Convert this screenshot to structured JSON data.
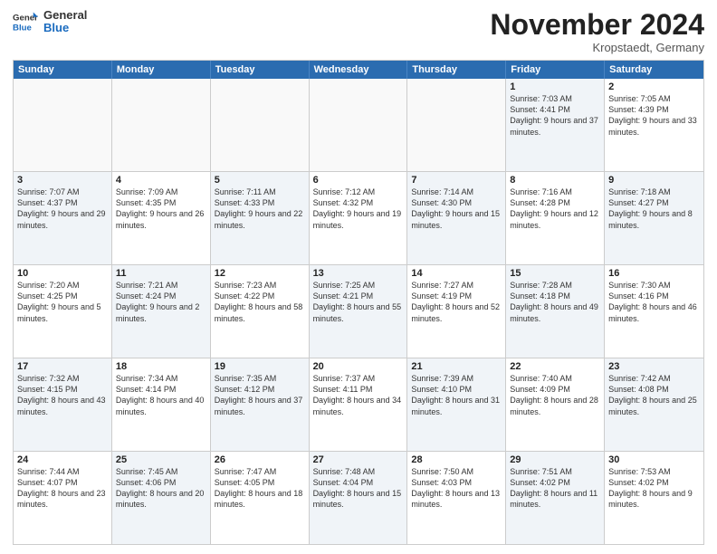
{
  "header": {
    "logo_general": "General",
    "logo_blue": "Blue",
    "month_title": "November 2024",
    "location": "Kropstaedt, Germany"
  },
  "weekdays": [
    "Sunday",
    "Monday",
    "Tuesday",
    "Wednesday",
    "Thursday",
    "Friday",
    "Saturday"
  ],
  "rows": [
    [
      {
        "day": "",
        "text": "",
        "empty": true
      },
      {
        "day": "",
        "text": "",
        "empty": true
      },
      {
        "day": "",
        "text": "",
        "empty": true
      },
      {
        "day": "",
        "text": "",
        "empty": true
      },
      {
        "day": "",
        "text": "",
        "empty": true
      },
      {
        "day": "1",
        "text": "Sunrise: 7:03 AM\nSunset: 4:41 PM\nDaylight: 9 hours and 37 minutes.",
        "shade": true
      },
      {
        "day": "2",
        "text": "Sunrise: 7:05 AM\nSunset: 4:39 PM\nDaylight: 9 hours and 33 minutes.",
        "shade": false
      }
    ],
    [
      {
        "day": "3",
        "text": "Sunrise: 7:07 AM\nSunset: 4:37 PM\nDaylight: 9 hours and 29 minutes.",
        "shade": true
      },
      {
        "day": "4",
        "text": "Sunrise: 7:09 AM\nSunset: 4:35 PM\nDaylight: 9 hours and 26 minutes.",
        "shade": false
      },
      {
        "day": "5",
        "text": "Sunrise: 7:11 AM\nSunset: 4:33 PM\nDaylight: 9 hours and 22 minutes.",
        "shade": true
      },
      {
        "day": "6",
        "text": "Sunrise: 7:12 AM\nSunset: 4:32 PM\nDaylight: 9 hours and 19 minutes.",
        "shade": false
      },
      {
        "day": "7",
        "text": "Sunrise: 7:14 AM\nSunset: 4:30 PM\nDaylight: 9 hours and 15 minutes.",
        "shade": true
      },
      {
        "day": "8",
        "text": "Sunrise: 7:16 AM\nSunset: 4:28 PM\nDaylight: 9 hours and 12 minutes.",
        "shade": false
      },
      {
        "day": "9",
        "text": "Sunrise: 7:18 AM\nSunset: 4:27 PM\nDaylight: 9 hours and 8 minutes.",
        "shade": true
      }
    ],
    [
      {
        "day": "10",
        "text": "Sunrise: 7:20 AM\nSunset: 4:25 PM\nDaylight: 9 hours and 5 minutes.",
        "shade": false
      },
      {
        "day": "11",
        "text": "Sunrise: 7:21 AM\nSunset: 4:24 PM\nDaylight: 9 hours and 2 minutes.",
        "shade": true
      },
      {
        "day": "12",
        "text": "Sunrise: 7:23 AM\nSunset: 4:22 PM\nDaylight: 8 hours and 58 minutes.",
        "shade": false
      },
      {
        "day": "13",
        "text": "Sunrise: 7:25 AM\nSunset: 4:21 PM\nDaylight: 8 hours and 55 minutes.",
        "shade": true
      },
      {
        "day": "14",
        "text": "Sunrise: 7:27 AM\nSunset: 4:19 PM\nDaylight: 8 hours and 52 minutes.",
        "shade": false
      },
      {
        "day": "15",
        "text": "Sunrise: 7:28 AM\nSunset: 4:18 PM\nDaylight: 8 hours and 49 minutes.",
        "shade": true
      },
      {
        "day": "16",
        "text": "Sunrise: 7:30 AM\nSunset: 4:16 PM\nDaylight: 8 hours and 46 minutes.",
        "shade": false
      }
    ],
    [
      {
        "day": "17",
        "text": "Sunrise: 7:32 AM\nSunset: 4:15 PM\nDaylight: 8 hours and 43 minutes.",
        "shade": true
      },
      {
        "day": "18",
        "text": "Sunrise: 7:34 AM\nSunset: 4:14 PM\nDaylight: 8 hours and 40 minutes.",
        "shade": false
      },
      {
        "day": "19",
        "text": "Sunrise: 7:35 AM\nSunset: 4:12 PM\nDaylight: 8 hours and 37 minutes.",
        "shade": true
      },
      {
        "day": "20",
        "text": "Sunrise: 7:37 AM\nSunset: 4:11 PM\nDaylight: 8 hours and 34 minutes.",
        "shade": false
      },
      {
        "day": "21",
        "text": "Sunrise: 7:39 AM\nSunset: 4:10 PM\nDaylight: 8 hours and 31 minutes.",
        "shade": true
      },
      {
        "day": "22",
        "text": "Sunrise: 7:40 AM\nSunset: 4:09 PM\nDaylight: 8 hours and 28 minutes.",
        "shade": false
      },
      {
        "day": "23",
        "text": "Sunrise: 7:42 AM\nSunset: 4:08 PM\nDaylight: 8 hours and 25 minutes.",
        "shade": true
      }
    ],
    [
      {
        "day": "24",
        "text": "Sunrise: 7:44 AM\nSunset: 4:07 PM\nDaylight: 8 hours and 23 minutes.",
        "shade": false
      },
      {
        "day": "25",
        "text": "Sunrise: 7:45 AM\nSunset: 4:06 PM\nDaylight: 8 hours and 20 minutes.",
        "shade": true
      },
      {
        "day": "26",
        "text": "Sunrise: 7:47 AM\nSunset: 4:05 PM\nDaylight: 8 hours and 18 minutes.",
        "shade": false
      },
      {
        "day": "27",
        "text": "Sunrise: 7:48 AM\nSunset: 4:04 PM\nDaylight: 8 hours and 15 minutes.",
        "shade": true
      },
      {
        "day": "28",
        "text": "Sunrise: 7:50 AM\nSunset: 4:03 PM\nDaylight: 8 hours and 13 minutes.",
        "shade": false
      },
      {
        "day": "29",
        "text": "Sunrise: 7:51 AM\nSunset: 4:02 PM\nDaylight: 8 hours and 11 minutes.",
        "shade": true
      },
      {
        "day": "30",
        "text": "Sunrise: 7:53 AM\nSunset: 4:02 PM\nDaylight: 8 hours and 9 minutes.",
        "shade": false
      }
    ]
  ]
}
